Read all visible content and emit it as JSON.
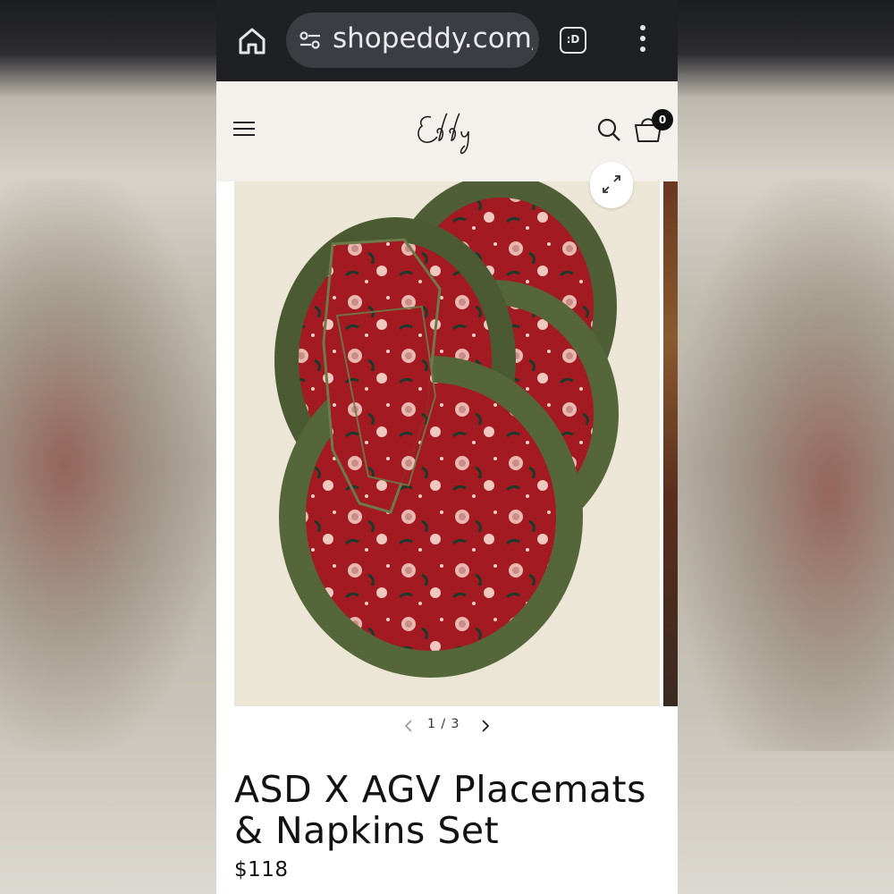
{
  "browser": {
    "url": "shopeddy.com/",
    "tab_badge": ":D",
    "icons": [
      "home-icon",
      "site-settings-icon",
      "tab-switcher-icon",
      "more-vert-icon"
    ]
  },
  "header": {
    "logo_text": "Eddy",
    "cart_count": "0",
    "icons": [
      "menu-icon",
      "search-icon",
      "cart-icon"
    ]
  },
  "gallery": {
    "image_description_icon": "expand-icon",
    "pagination": "1 / 3"
  },
  "product": {
    "title": "ASD X AGV Placemats & Napkins Set",
    "price": "$118"
  },
  "colors": {
    "browser_bar": "#1f2024",
    "header_bg": "#f4f1ec",
    "mat_red": "#a31a22",
    "ruffle_green": "#4f5e36"
  }
}
